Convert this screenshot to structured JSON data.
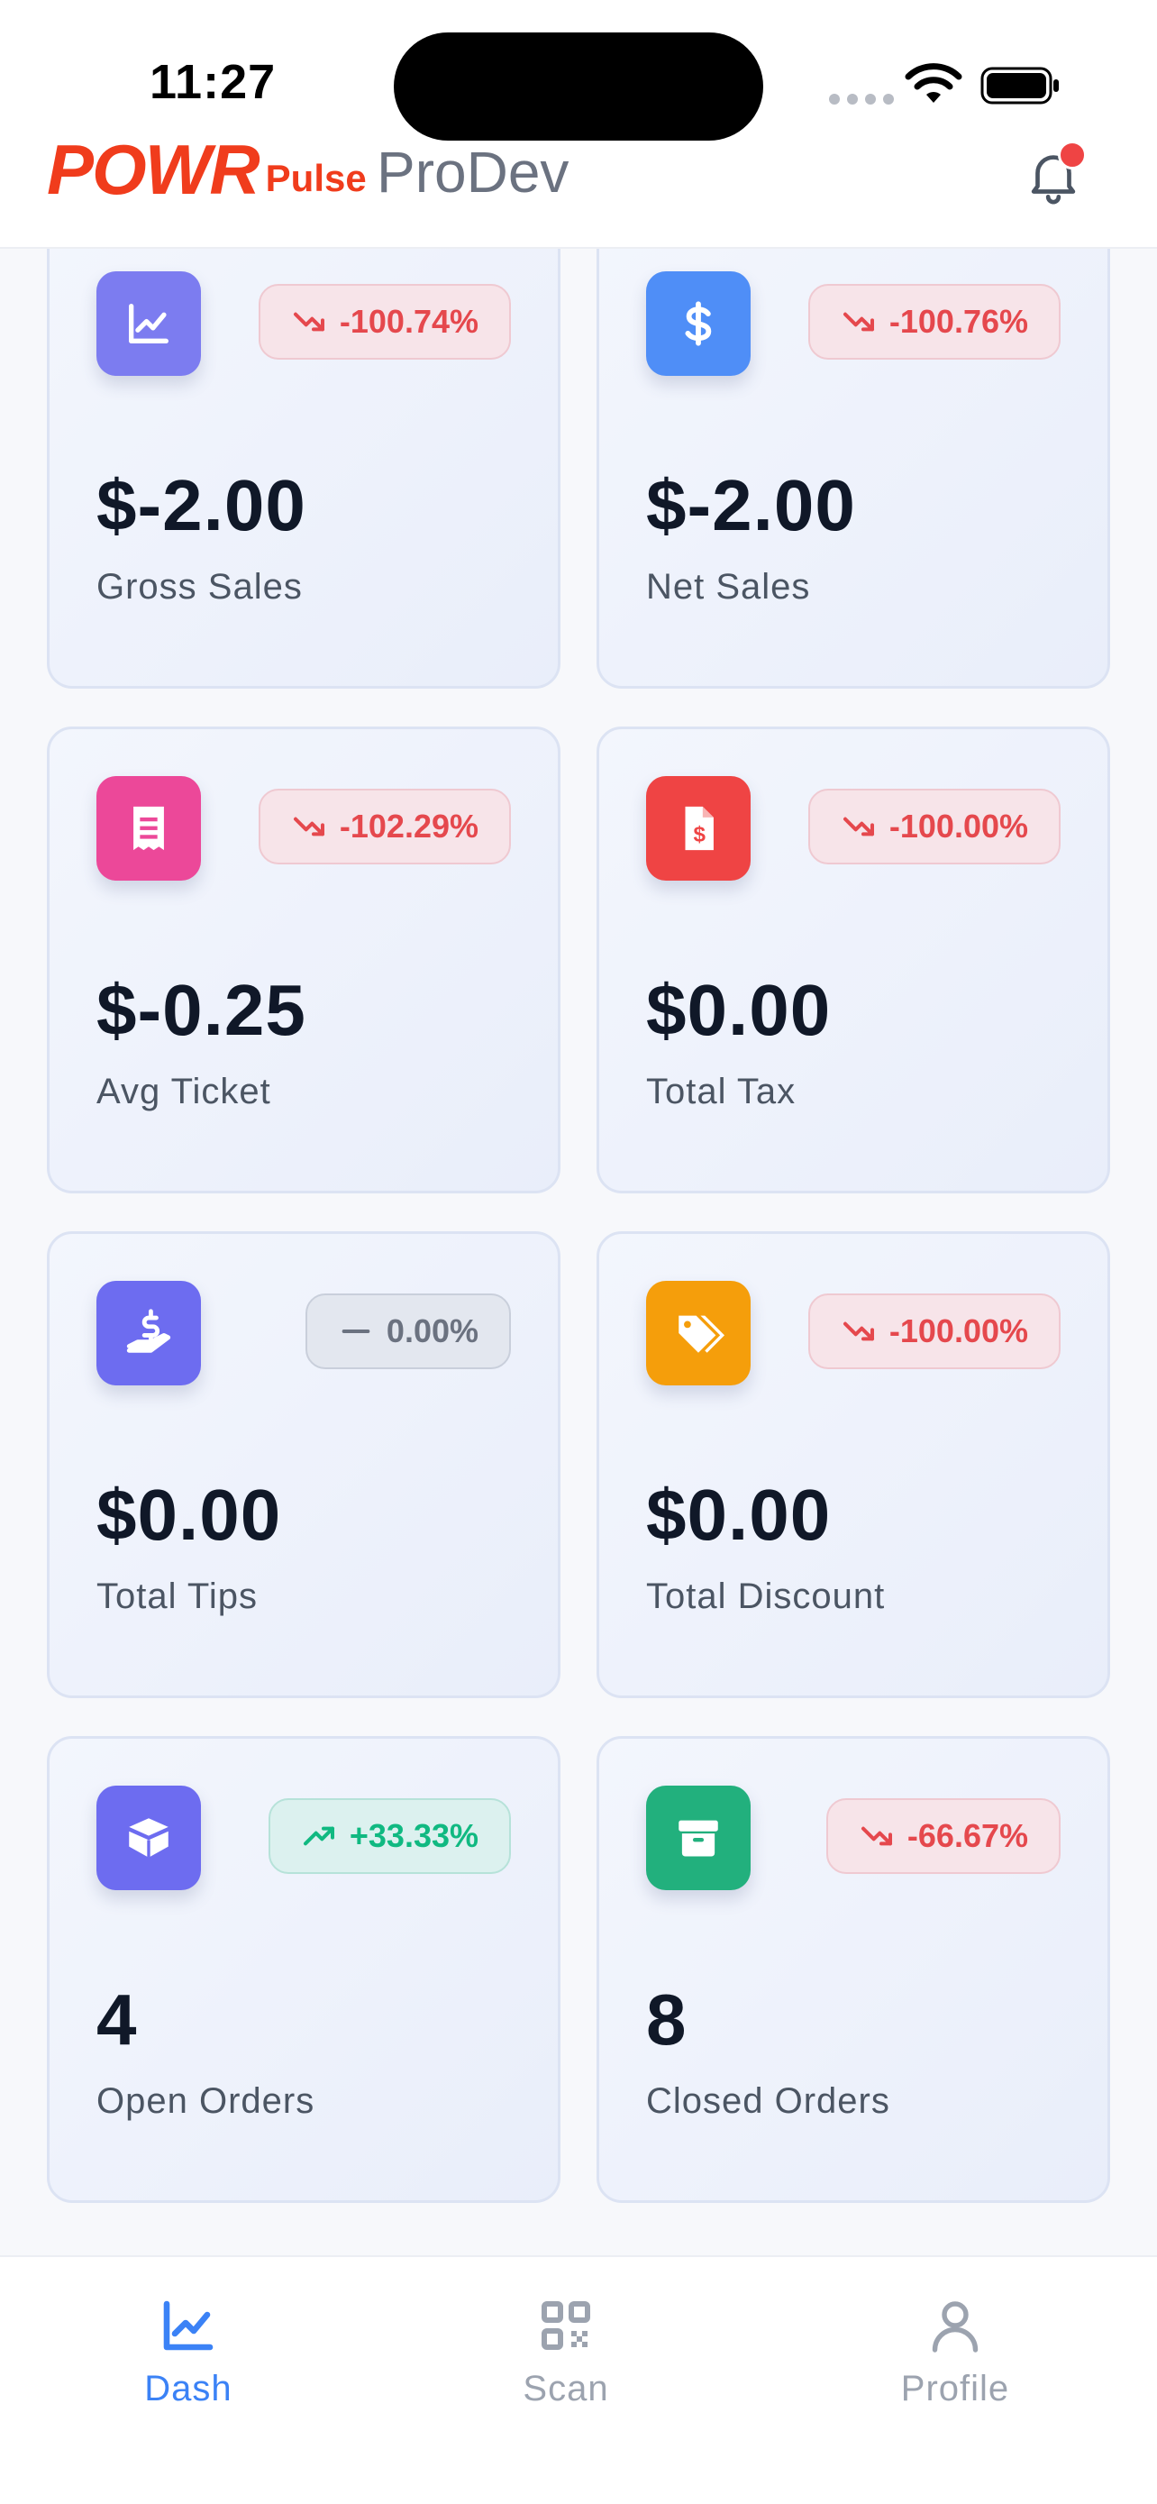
{
  "status_bar": {
    "time": "11:27"
  },
  "header": {
    "logo_main": "POWR",
    "logo_sub": "Pulse",
    "store_name": "ProDev"
  },
  "colors": {
    "accent": "#3b82f6",
    "negative": "#e5484d",
    "positive": "#10b981",
    "brand": "#f03c1c"
  },
  "metrics": [
    {
      "label": "Gross Sales",
      "value": "$-2.00",
      "change": "-100.74%",
      "trend": "down",
      "icon": "chart-line-icon",
      "icon_color": "#7c7cf0"
    },
    {
      "label": "Net Sales",
      "value": "$-2.00",
      "change": "-100.76%",
      "trend": "down",
      "icon": "dollar-icon",
      "icon_color": "#4f8ef7"
    },
    {
      "label": "Avg Ticket",
      "value": "$-0.25",
      "change": "-102.29%",
      "trend": "down",
      "icon": "receipt-icon",
      "icon_color": "#ec4899"
    },
    {
      "label": "Total Tax",
      "value": "$0.00",
      "change": "-100.00%",
      "trend": "down",
      "icon": "invoice-dollar-icon",
      "icon_color": "#ef4444"
    },
    {
      "label": "Total Tips",
      "value": "$0.00",
      "change": "0.00%",
      "trend": "flat",
      "icon": "hand-dollar-icon",
      "icon_color": "#6d6cf0"
    },
    {
      "label": "Total Discount",
      "value": "$0.00",
      "change": "-100.00%",
      "trend": "down",
      "icon": "tags-icon",
      "icon_color": "#f59e0b"
    },
    {
      "label": "Open Orders",
      "value": "4",
      "change": "+33.33%",
      "trend": "up",
      "icon": "box-open-icon",
      "icon_color": "#6d6cf0"
    },
    {
      "label": "Closed Orders",
      "value": "8",
      "change": "-66.67%",
      "trend": "down",
      "icon": "archive-icon",
      "icon_color": "#22b07d"
    }
  ],
  "nav": {
    "items": [
      {
        "label": "Dash",
        "icon": "chart-line-icon",
        "active": true
      },
      {
        "label": "Scan",
        "icon": "qr-code-icon",
        "active": false
      },
      {
        "label": "Profile",
        "icon": "user-icon",
        "active": false
      }
    ]
  }
}
